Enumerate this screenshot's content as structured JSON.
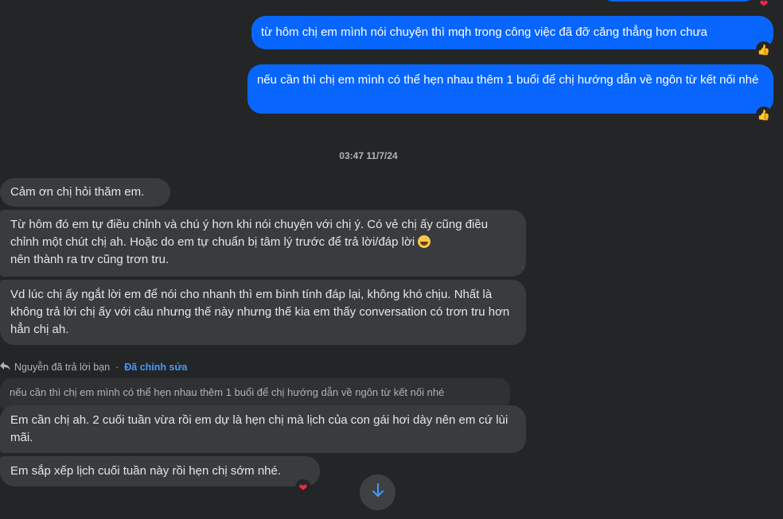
{
  "outgoing": [
    {
      "text": "từ hôm chị em mình nói chuyện thì mqh trong công việc đã đỡ căng thẳng hơn chưa",
      "reaction": "thumbs-up"
    },
    {
      "text": "nếu cần thì chị em mình có thể hẹn nhau thêm 1 buổi để chị hướng dẫn về ngôn từ kết nối nhé",
      "reaction": "thumbs-up"
    }
  ],
  "timestamp": "03:47 11/7/24",
  "incoming": [
    {
      "text": "Cảm ơn chị hỏi thăm em."
    },
    {
      "text": "Từ hôm đó em tự điều chỉnh và chú ý hơn khi nói chuyện với chị ý. Có vẻ chị ấy cũng điều chỉnh một chút chị ah. Hoặc do em tự chuẩn bị tâm lý trước để trả lời/đáp lời",
      "text_after": "nên thành ra trv cũng trơn tru.",
      "emoji": "grinning-face-sweat"
    },
    {
      "text": "Vd lúc chị ấy ngắt lời em để nói cho nhanh thì em bình tính đáp lại, không khó chịu. Nhất là không trả lời chị ấy với câu nhưng thế này nhưng thế kia em thấy conversation có trơn tru hơn hẳn chị ah."
    }
  ],
  "reply_meta": {
    "label": "Nguyễn đã trả lời bạn",
    "separator": "·",
    "edited": "Đã chỉnh sửa"
  },
  "quoted_message": "nếu cần thì chị em mình có thể hẹn nhau thêm 1 buổi để chị hướng dẫn về ngôn từ kết nối nhé",
  "replies": [
    {
      "text": "Em cần chị ah. 2 cuối tuần vừa rồi em dự là hẹn chị mà lịch của con gái hơi dày nên em cứ lùi mãi."
    },
    {
      "text": "Em sắp xếp lịch cuối tuần này rồi hẹn chị sớm nhé.",
      "reaction": "heart"
    }
  ],
  "colors": {
    "background": "#242526",
    "outgoing_bubble": "#0866ff",
    "incoming_bubble": "#3a3b3c",
    "accent": "#4599ff"
  },
  "icons": {
    "reply": "reply-arrow-icon",
    "scroll": "arrow-down-icon"
  }
}
